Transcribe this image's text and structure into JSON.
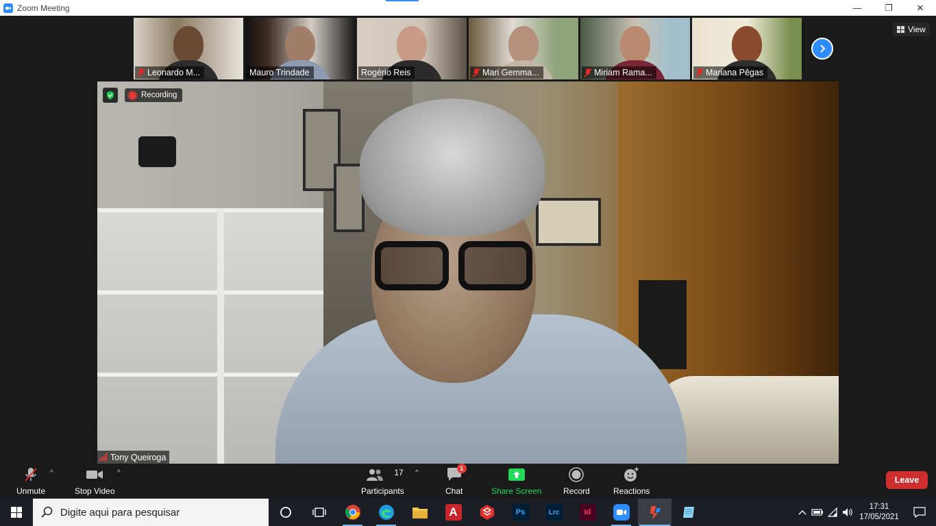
{
  "window": {
    "title": "Zoom Meeting"
  },
  "gallery": {
    "participants": [
      {
        "name": "Leonardo M...",
        "muted": true
      },
      {
        "name": "Mauro Trindade",
        "muted": false
      },
      {
        "name": "Rogério Reis",
        "muted": false
      },
      {
        "name": "Mari Gemma...",
        "muted": true
      },
      {
        "name": "Miriam Rama...",
        "muted": true
      },
      {
        "name": "Mariana Pêgas",
        "muted": true
      }
    ],
    "view_label": "View"
  },
  "main_video": {
    "recording_label": "Recording",
    "speaker_name": "Tony Queiroga"
  },
  "controls": {
    "unmute": "Unmute",
    "stop_video": "Stop Video",
    "participants": "Participants",
    "participants_count": "17",
    "chat": "Chat",
    "chat_badge": "1",
    "share_screen": "Share Screen",
    "record": "Record",
    "reactions": "Reactions",
    "leave": "Leave"
  },
  "taskbar": {
    "search_placeholder": "Digite aqui para pesquisar",
    "apps": [
      {
        "name": "Chrome"
      },
      {
        "name": "Edge"
      },
      {
        "name": "File Explorer"
      },
      {
        "name": "Acrobat",
        "letter": "A"
      },
      {
        "name": "SketchUp"
      },
      {
        "name": "Photoshop",
        "letter": "Ps"
      },
      {
        "name": "Lightroom Classic",
        "letter": "Lrc"
      },
      {
        "name": "InDesign",
        "letter": "Id"
      },
      {
        "name": "Zoom"
      },
      {
        "name": "Active App"
      },
      {
        "name": "Notepad"
      }
    ],
    "time": "17:31",
    "date": "17/05/2021"
  },
  "colors": {
    "zoom_blue": "#2d8cff",
    "leave_red": "#cf2e2e",
    "share_green": "#23d959",
    "mute_red": "#e02828"
  }
}
